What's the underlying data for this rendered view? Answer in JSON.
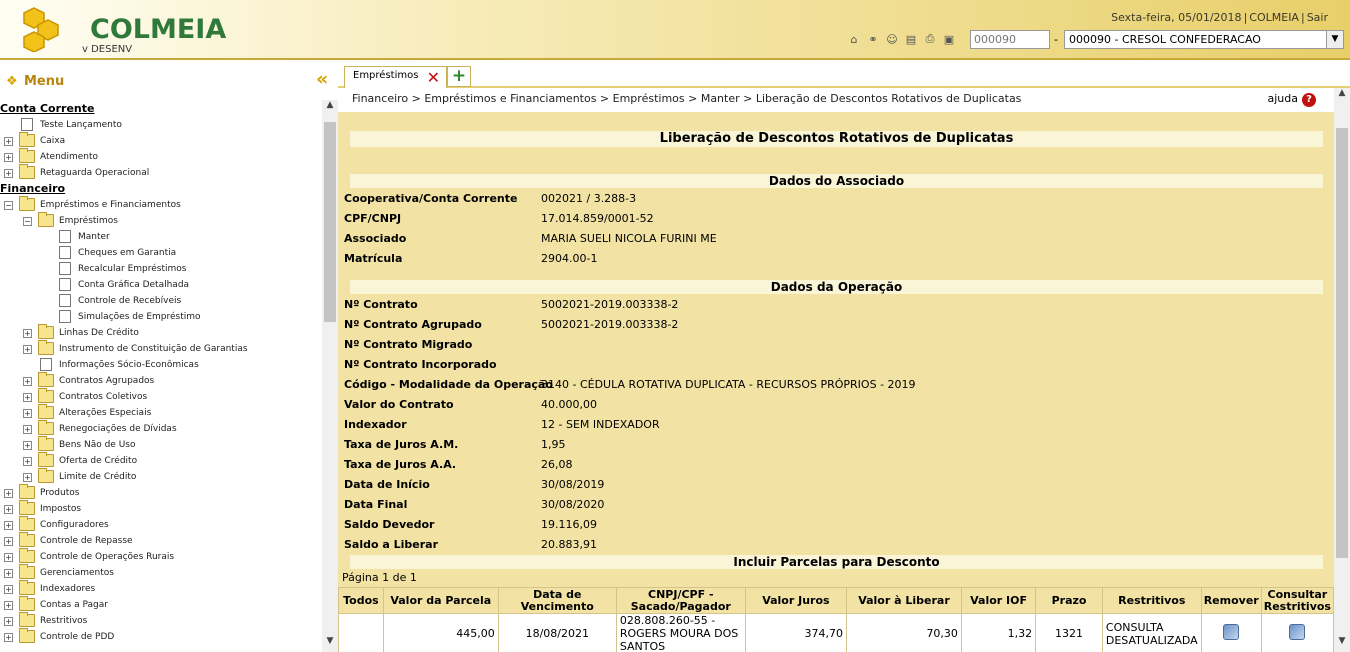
{
  "header": {
    "logo_text": "COLMEIA",
    "logo_sub": "v DESENV",
    "date": "Sexta-feira, 05/01/2018",
    "system": "COLMEIA",
    "logout": "Sair",
    "coop_code": "000090",
    "coop_name": "000090 - CRESOL CONFEDERACAO"
  },
  "sidebar": {
    "title": "Menu",
    "sections": [
      {
        "label": "Conta Corrente",
        "items": [
          {
            "label": "Teste Lançamento",
            "level": 1,
            "type": "doc"
          },
          {
            "label": "Caixa",
            "level": 1,
            "type": "folder"
          },
          {
            "label": "Atendimento",
            "level": 1,
            "type": "folder"
          },
          {
            "label": "Retaguarda Operacional",
            "level": 1,
            "type": "folder"
          }
        ]
      },
      {
        "label": "Financeiro",
        "items": [
          {
            "label": "Empréstimos e Financiamentos",
            "level": 1,
            "type": "folder",
            "open": true
          },
          {
            "label": "Empréstimos",
            "level": 2,
            "type": "folder",
            "open": true
          },
          {
            "label": "Manter",
            "level": 3,
            "type": "doc"
          },
          {
            "label": "Cheques em Garantia",
            "level": 3,
            "type": "doc"
          },
          {
            "label": "Recalcular Empréstimos",
            "level": 3,
            "type": "doc"
          },
          {
            "label": "Conta Gráfica Detalhada",
            "level": 3,
            "type": "doc"
          },
          {
            "label": "Controle de Recebíveis",
            "level": 3,
            "type": "doc"
          },
          {
            "label": "Simulações de Empréstimo",
            "level": 3,
            "type": "doc"
          },
          {
            "label": "Linhas De Crédito",
            "level": 2,
            "type": "folder"
          },
          {
            "label": "Instrumento de Constituição de Garantias",
            "level": 2,
            "type": "folder"
          },
          {
            "label": "Informações Sócio-Econômicas",
            "level": 2,
            "type": "doc"
          },
          {
            "label": "Contratos Agrupados",
            "level": 2,
            "type": "folder"
          },
          {
            "label": "Contratos Coletivos",
            "level": 2,
            "type": "folder"
          },
          {
            "label": "Alterações Especiais",
            "level": 2,
            "type": "folder"
          },
          {
            "label": "Renegociações de Dívidas",
            "level": 2,
            "type": "folder"
          },
          {
            "label": "Bens Não de Uso",
            "level": 2,
            "type": "folder"
          },
          {
            "label": "Oferta de Crédito",
            "level": 2,
            "type": "folder"
          },
          {
            "label": "Limite de Crédito",
            "level": 2,
            "type": "folder"
          },
          {
            "label": "Produtos",
            "level": 1,
            "type": "folder"
          },
          {
            "label": "Impostos",
            "level": 1,
            "type": "folder"
          },
          {
            "label": "Configuradores",
            "level": 1,
            "type": "folder"
          },
          {
            "label": "Controle de Repasse",
            "level": 1,
            "type": "folder"
          },
          {
            "label": "Controle de Operações Rurais",
            "level": 1,
            "type": "folder"
          },
          {
            "label": "Gerenciamentos",
            "level": 1,
            "type": "folder"
          },
          {
            "label": "Indexadores",
            "level": 1,
            "type": "folder"
          },
          {
            "label": "Contas a Pagar",
            "level": 1,
            "type": "folder"
          },
          {
            "label": "Restritivos",
            "level": 1,
            "type": "folder"
          },
          {
            "label": "Controle de PDD",
            "level": 1,
            "type": "folder"
          }
        ]
      }
    ]
  },
  "tab": {
    "label": "Empréstimos"
  },
  "breadcrumb": "Financeiro > Empréstimos e Financiamentos > Empréstimos > Manter > Liberação de Descontos Rotativos de Duplicatas",
  "help": "ajuda",
  "page_title": "Liberação de Descontos Rotativos de Duplicatas",
  "assoc": {
    "title": "Dados do Associado",
    "fields": [
      {
        "label": "Cooperativa/Conta Corrente",
        "value": "002021 / 3.288-3"
      },
      {
        "label": "CPF/CNPJ",
        "value": "17.014.859/0001-52"
      },
      {
        "label": "Associado",
        "value": "MARIA SUELI NICOLA FURINI ME"
      },
      {
        "label": "Matrícula",
        "value": "2904.00-1"
      }
    ]
  },
  "oper": {
    "title": "Dados da Operação",
    "fields": [
      {
        "label": "Nº Contrato",
        "value": "5002021-2019.003338-2"
      },
      {
        "label": "Nº Contrato Agrupado",
        "value": "5002021-2019.003338-2"
      },
      {
        "label": "Nº Contrato Migrado",
        "value": ""
      },
      {
        "label": "Nº Contrato Incorporado",
        "value": ""
      },
      {
        "label": "Código - Modalidade da Operação",
        "value": "3140 - CÉDULA ROTATIVA DUPLICATA - RECURSOS PRÓPRIOS - 2019"
      },
      {
        "label": "Valor do Contrato",
        "value": "40.000,00"
      },
      {
        "label": "Indexador",
        "value": "12 - SEM INDEXADOR"
      },
      {
        "label": "Taxa de Juros A.M.",
        "value": "1,95"
      },
      {
        "label": "Taxa de Juros A.A.",
        "value": "26,08"
      },
      {
        "label": "Data de Início",
        "value": "30/08/2019"
      },
      {
        "label": "Data Final",
        "value": "30/08/2020"
      },
      {
        "label": "Saldo Devedor",
        "value": "19.116,09"
      },
      {
        "label": "Saldo a Liberar",
        "value": "20.883,91"
      }
    ]
  },
  "parcelas": {
    "title": "Incluir Parcelas para Desconto",
    "pagination": "Página 1 de 1",
    "columns": [
      "Todos",
      "Valor da Parcela",
      "Data de Vencimento",
      "CNPJ/CPF - Sacado/Pagador",
      "Valor Juros",
      "Valor à Liberar",
      "Valor IOF",
      "Prazo",
      "Restritivos",
      "Remover",
      "Consultar Restritivos"
    ],
    "rows": [
      {
        "valor": "445,00",
        "venc": "18/08/2021",
        "sacado": "028.808.260-55 - ROGERS MOURA DOS SANTOS",
        "juros": "374,70",
        "liberar": "70,30",
        "iof": "1,32",
        "prazo": "1321",
        "restritivos": "CONSULTA DESATUALIZADA"
      }
    ]
  }
}
